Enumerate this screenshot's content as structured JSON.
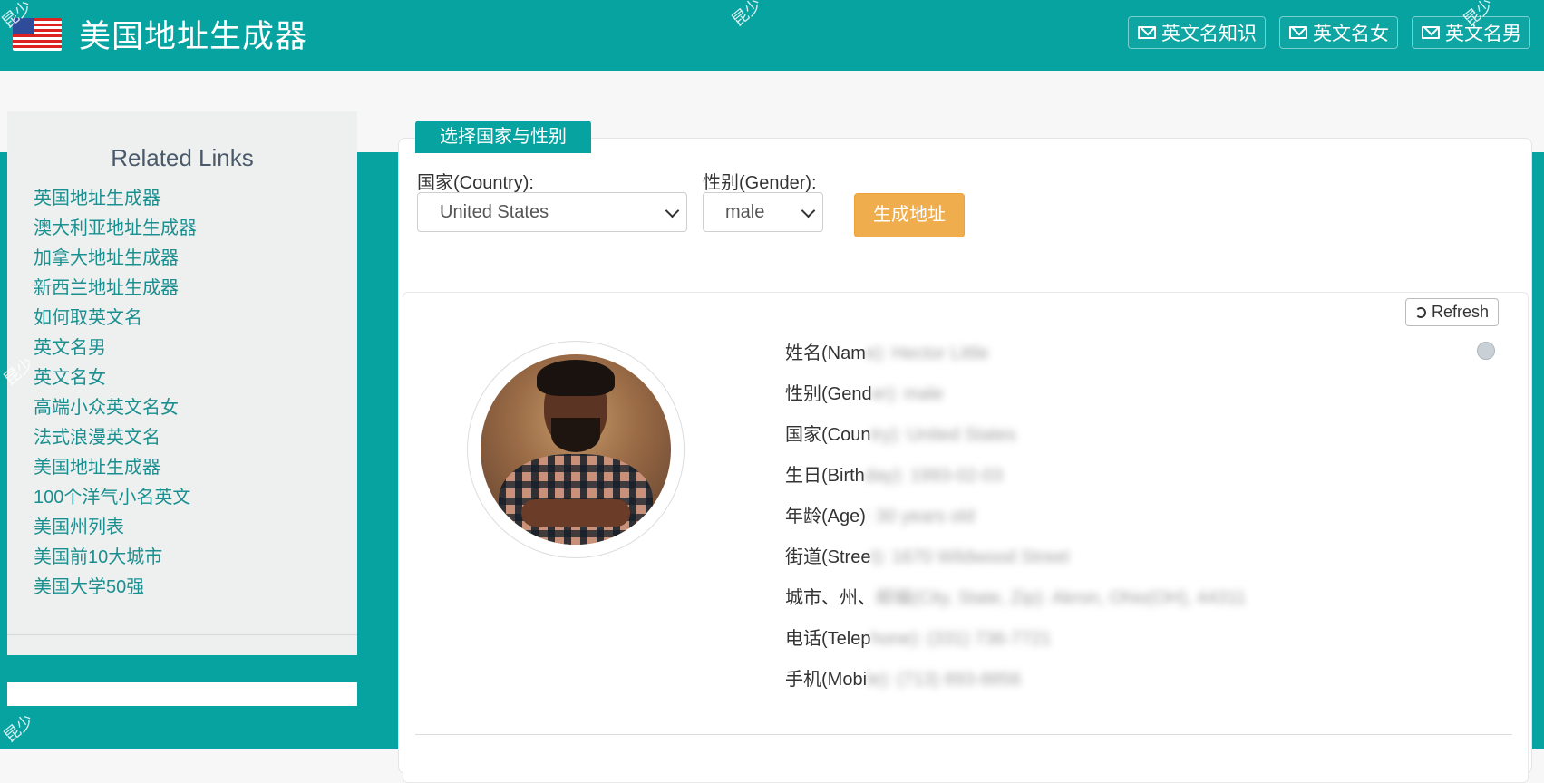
{
  "header": {
    "title": "美国地址生成器",
    "nav": [
      "英文名知识",
      "英文名女",
      "英文名男"
    ]
  },
  "sidebar": {
    "title": "Related Links",
    "links": [
      "英国地址生成器",
      "澳大利亚地址生成器",
      "加拿大地址生成器",
      "新西兰地址生成器",
      "如何取英文名",
      "英文名男",
      "英文名女",
      "高端小众英文名女",
      "法式浪漫英文名",
      "美国地址生成器",
      "100个洋气小名英文",
      "美国州列表",
      "美国前10大城市",
      "美国大学50强"
    ]
  },
  "form": {
    "tab_label": "选择国家与性别",
    "country_label": "国家(Country):",
    "country_value": "United States",
    "gender_label": "性别(Gender):",
    "gender_value": "male",
    "generate_label": "生成地址"
  },
  "result": {
    "refresh_label": "Refresh",
    "rows": [
      {
        "label": "姓名(Nam",
        "value": "e): Hector Little"
      },
      {
        "label": "性别(Gend",
        "value": "er): male"
      },
      {
        "label": "国家(Coun",
        "value": "try): United States"
      },
      {
        "label": "生日(Birth",
        "value": "day): 1993-02-03"
      },
      {
        "label": "年龄(Age)",
        "value": ": 30 years old"
      },
      {
        "label": "街道(Stree",
        "value": "t): 1670 Wildwood Street"
      },
      {
        "label": "城市、州、",
        "value": "邮编(City, State, Zip): Akron, Ohio(OH), 44311"
      },
      {
        "label": "电话(Telep",
        "value": "hone): (331) 736-7721"
      },
      {
        "label": "手机(Mobi",
        "value": "le): (713) 893-8856"
      }
    ]
  },
  "colors": {
    "teal": "#07a3a1",
    "orange": "#f0ad4e",
    "link": "#1b8f8f"
  },
  "watermark": "昆少"
}
